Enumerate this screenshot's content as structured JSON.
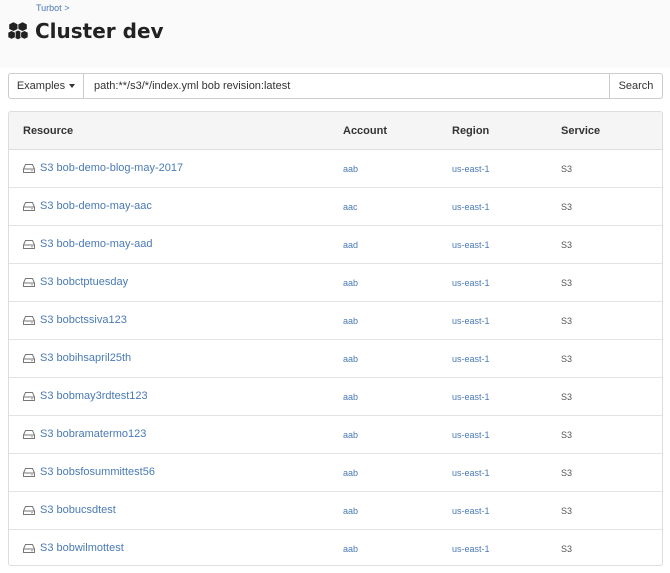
{
  "breadcrumb": {
    "root": "Turbot",
    "separator": ">"
  },
  "page": {
    "title": "Cluster dev",
    "icon": "cubes-icon"
  },
  "search": {
    "examples_label": "Examples",
    "query": "path:**/s3/*/index.yml bob revision:latest",
    "button_label": "Search"
  },
  "table": {
    "headers": {
      "resource": "Resource",
      "account": "Account",
      "region": "Region",
      "service": "Service"
    },
    "rows": [
      {
        "resource": "S3 bob-demo-blog-may-2017",
        "account": "aab",
        "region": "us-east-1",
        "service": "S3"
      },
      {
        "resource": "S3 bob-demo-may-aac",
        "account": "aac",
        "region": "us-east-1",
        "service": "S3"
      },
      {
        "resource": "S3 bob-demo-may-aad",
        "account": "aad",
        "region": "us-east-1",
        "service": "S3"
      },
      {
        "resource": "S3 bobctptuesday",
        "account": "aab",
        "region": "us-east-1",
        "service": "S3"
      },
      {
        "resource": "S3 bobctssiva123",
        "account": "aab",
        "region": "us-east-1",
        "service": "S3"
      },
      {
        "resource": "S3 bobihsapril25th",
        "account": "aab",
        "region": "us-east-1",
        "service": "S3"
      },
      {
        "resource": "S3 bobmay3rdtest123",
        "account": "aab",
        "region": "us-east-1",
        "service": "S3"
      },
      {
        "resource": "S3 bobramatermo123",
        "account": "aab",
        "region": "us-east-1",
        "service": "S3"
      },
      {
        "resource": "S3 bobsfosummittest56",
        "account": "aab",
        "region": "us-east-1",
        "service": "S3"
      },
      {
        "resource": "S3 bobucsdtest",
        "account": "aab",
        "region": "us-east-1",
        "service": "S3"
      },
      {
        "resource": "S3 bobwilmottest",
        "account": "aab",
        "region": "us-east-1",
        "service": "S3"
      }
    ]
  },
  "colors": {
    "link": "#4a7ab5",
    "header_bg": "#f5f5f5",
    "border": "#dddddd"
  }
}
